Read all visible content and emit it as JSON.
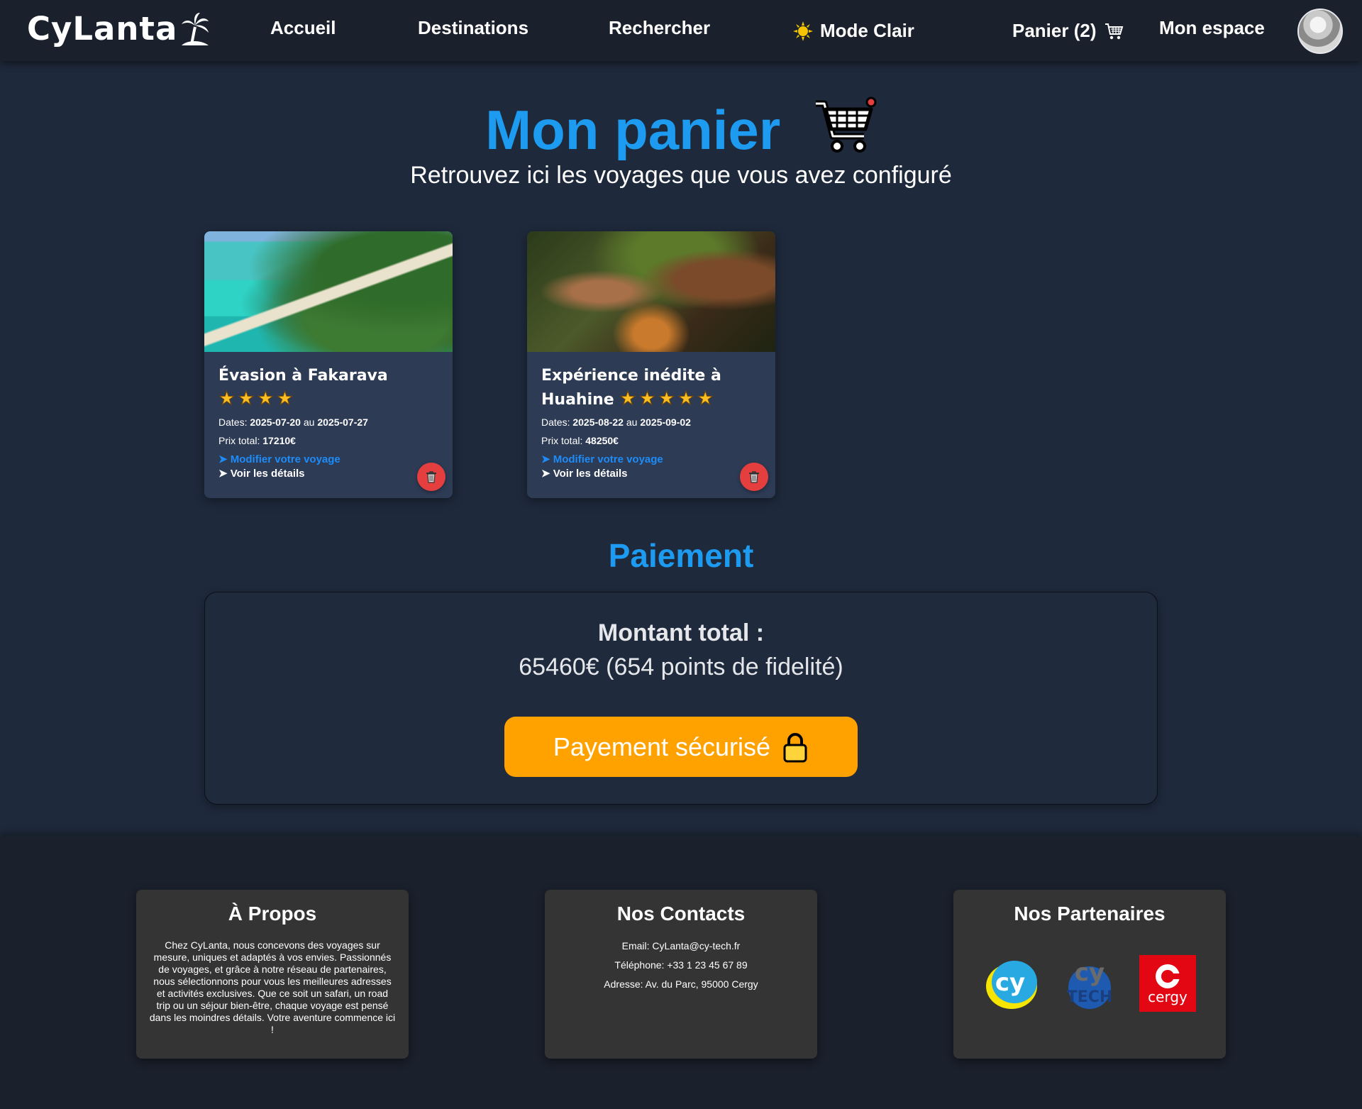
{
  "colors": {
    "accent": "#1d9bf0",
    "background": "#1e293b",
    "navbar": "#1a202c",
    "card": "#2d3b55",
    "pay_button": "#ffa200",
    "delete_button": "#e53e3e",
    "link": "#1d8cf8",
    "star": "#fbbf24"
  },
  "header": {
    "logo_text": "CyLanta",
    "logo_icon": "palm-tree-icon",
    "nav": {
      "home": "Accueil",
      "destinations": "Destinations",
      "search": "Rechercher",
      "mode": "Mode Clair",
      "cart": "Panier (2)",
      "account": "Mon espace"
    }
  },
  "hero": {
    "title": "Mon panier",
    "subtitle": "Retrouvez ici les voyages que vous avez configuré"
  },
  "cart": {
    "items": [
      {
        "title": "Évasion à Fakarava",
        "rating": 4,
        "stars": "★★★★",
        "dates_label": "Dates:",
        "date_start": "2025-07-20",
        "date_sep": "au",
        "date_end": "2025-07-27",
        "price_label": "Prix total:",
        "price": "17210€",
        "modify_link": "➤ Modifier votre voyage",
        "details_link": "➤ Voir les détails"
      },
      {
        "title": "Expérience inédite à Huahine",
        "rating": 5,
        "stars": "★★★★★",
        "dates_label": "Dates:",
        "date_start": "2025-08-22",
        "date_sep": "au",
        "date_end": "2025-09-02",
        "price_label": "Prix total:",
        "price": "48250€",
        "modify_link": "➤ Modifier votre voyage",
        "details_link": "➤ Voir les détails"
      }
    ]
  },
  "payment": {
    "title": "Paiement",
    "total_label": "Montant total :",
    "total_value": "65460€ (654 points de fidelité)",
    "button_label": "Payement sécurisé"
  },
  "footer": {
    "about": {
      "title": "À Propos",
      "text": "Chez CyLanta, nous concevons des voyages sur mesure, uniques et adaptés à vos envies. Passionnés de voyages, et grâce à notre réseau de partenaires, nous sélectionnons pour vous les meilleures adresses et activités exclusives. Que ce soit un safari, un road trip ou un séjour bien-être, chaque voyage est pensé dans les moindres détails. Votre aventure commence ici !"
    },
    "contacts": {
      "title": "Nos Contacts",
      "email": "Email: CyLanta@cy-tech.fr",
      "phone": "Téléphone: +33 1 23 45 67 89",
      "address": "Adresse: Av. du Parc, 95000 Cergy"
    },
    "partners": {
      "title": "Nos Partenaires",
      "logos": [
        "cy-logo",
        "cy-tech-logo",
        "cergy-logo"
      ],
      "cergy_text": "cergy"
    }
  }
}
